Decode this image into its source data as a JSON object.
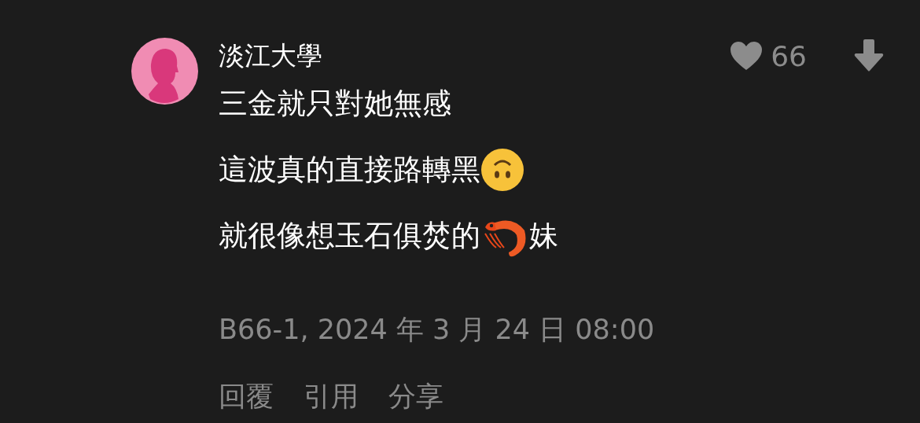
{
  "comment": {
    "author": "淡江大學",
    "likes": "66",
    "lines": [
      [
        {
          "kind": "text",
          "text": "三金就只對她無感"
        }
      ],
      [
        {
          "kind": "text",
          "text": "這波真的直接路轉黑"
        },
        {
          "kind": "upside-down-face"
        }
      ],
      [
        {
          "kind": "text",
          "text": "就很像想玉石俱焚的"
        },
        {
          "kind": "shrimp"
        },
        {
          "kind": "text",
          "text": "妹"
        }
      ]
    ],
    "meta": "B66-1, 2024 年 3 月 24 日 08:00",
    "actions": [
      "回覆",
      "引用",
      "分享"
    ]
  }
}
